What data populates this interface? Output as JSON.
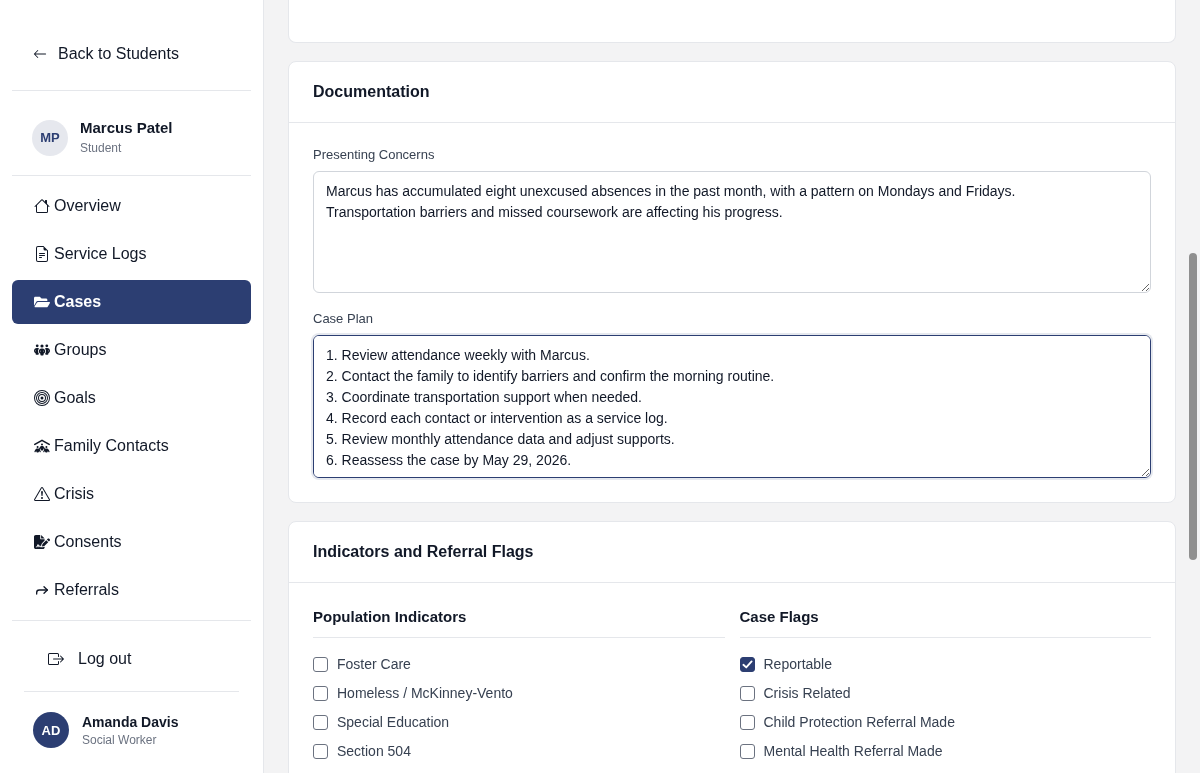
{
  "sidebar": {
    "back_link": "Back to Students",
    "student": {
      "initials": "MP",
      "name": "Marcus Patel",
      "role": "Student"
    },
    "nav": [
      {
        "label": "Overview",
        "selected": false
      },
      {
        "label": "Service Logs",
        "selected": false
      },
      {
        "label": "Cases",
        "selected": true
      },
      {
        "label": "Groups",
        "selected": false
      },
      {
        "label": "Goals",
        "selected": false
      },
      {
        "label": "Family Contacts",
        "selected": false
      },
      {
        "label": "Crisis",
        "selected": false
      },
      {
        "label": "Consents",
        "selected": false
      },
      {
        "label": "Referrals",
        "selected": false
      }
    ],
    "logout": "Log out",
    "user": {
      "initials": "AD",
      "name": "Amanda Davis",
      "role": "Social Worker"
    }
  },
  "documentation": {
    "title": "Documentation",
    "fields": [
      {
        "label": "Presenting Concerns",
        "value": "Marcus has accumulated eight unexcused absences in the past month, with a pattern on Mondays and Fridays.\nTransportation barriers and missed coursework are affecting his progress.",
        "focused": false
      },
      {
        "label": "Case Plan",
        "value": "1. Review attendance weekly with Marcus.\n2. Contact the family to identify barriers and confirm the morning routine.\n3. Coordinate transportation support when needed.\n4. Record each contact or intervention as a service log.\n5. Review monthly attendance data and adjust supports.\n6. Reassess the case by May 29, 2026.",
        "focused": true
      }
    ]
  },
  "indicators": {
    "title": "Indicators and Referral Flags",
    "groups": [
      {
        "title": "Population Indicators",
        "items": [
          {
            "label": "Foster Care",
            "checked": false
          },
          {
            "label": "Homeless / McKinney-Vento",
            "checked": false
          },
          {
            "label": "Special Education",
            "checked": false
          },
          {
            "label": "Section 504",
            "checked": false
          }
        ]
      },
      {
        "title": "Case Flags",
        "items": [
          {
            "label": "Reportable",
            "checked": true
          },
          {
            "label": "Crisis Related",
            "checked": false
          },
          {
            "label": "Child Protection Referral Made",
            "checked": false
          },
          {
            "label": "Mental Health Referral Made",
            "checked": false
          }
        ]
      }
    ]
  }
}
